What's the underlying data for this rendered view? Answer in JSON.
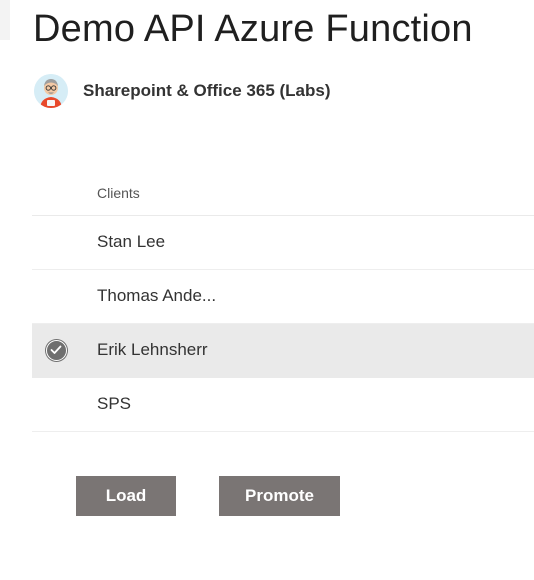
{
  "page": {
    "title": "Demo API Azure Function"
  },
  "site": {
    "name": "Sharepoint & Office 365 (Labs)",
    "avatar_icon": "cartoon-avatar"
  },
  "list": {
    "column_header": "Clients",
    "rows": [
      {
        "label": "Stan Lee",
        "selected": false
      },
      {
        "label": "Thomas Ande...",
        "selected": false
      },
      {
        "label": "Erik Lehnsherr",
        "selected": true
      },
      {
        "label": "SPS",
        "selected": false
      }
    ]
  },
  "actions": {
    "load_label": "Load",
    "promote_label": "Promote"
  },
  "colors": {
    "button_bg": "#7a7574",
    "selected_row_bg": "#eaeaea",
    "check_bg": "#6f6f6f"
  }
}
